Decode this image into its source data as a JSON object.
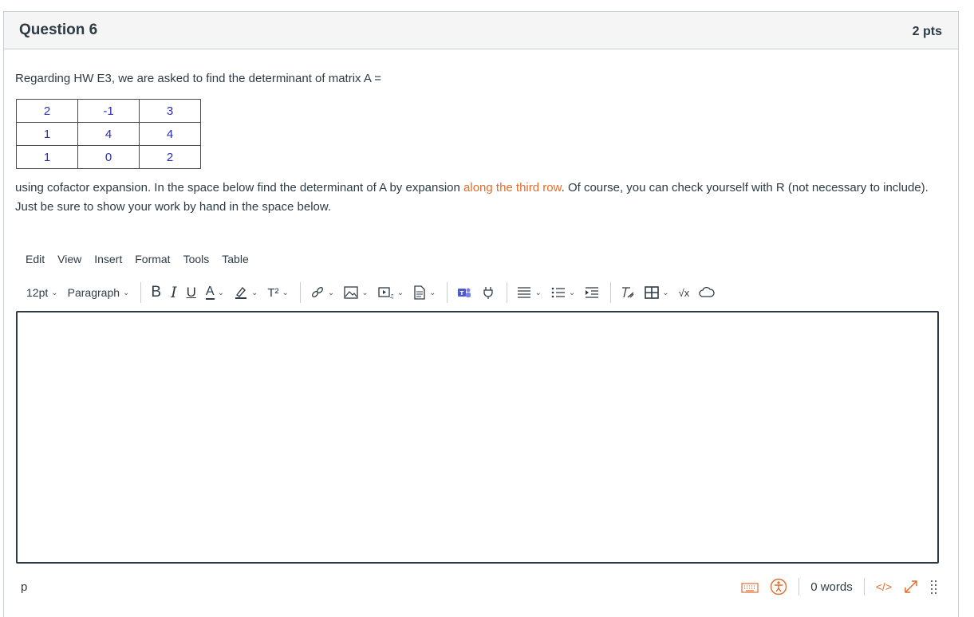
{
  "question": {
    "title": "Question 6",
    "points": "2 pts",
    "intro": "Regarding HW E3, we are asked to find the determinant of matrix A =",
    "matrix": [
      [
        "2",
        "-1",
        "3"
      ],
      [
        "1",
        "4",
        "4"
      ],
      [
        "1",
        "0",
        "2"
      ]
    ],
    "body_pre": "using cofactor expansion. In the space below find the determinant of A by expansion ",
    "body_highlight": "along the third row",
    "body_post": ". Of course, you can check yourself with R (not necessary to include).  Just be sure to show your work by hand in the space below."
  },
  "editor": {
    "menu": [
      "Edit",
      "View",
      "Insert",
      "Format",
      "Tools",
      "Table"
    ],
    "font_size": "12pt",
    "block_format": "Paragraph",
    "bold_label": "B",
    "italic_label": "I",
    "underline_label": "U",
    "text_color_label": "A",
    "superscript_label": "T²",
    "sqrt_label": "√x",
    "status_path": "p",
    "word_count": "0 words",
    "html_toggle": "</>"
  },
  "colors": {
    "highlight": "#e56c2c",
    "matrix_text": "#2b2bb5",
    "teams_icon": "#5059c9"
  }
}
